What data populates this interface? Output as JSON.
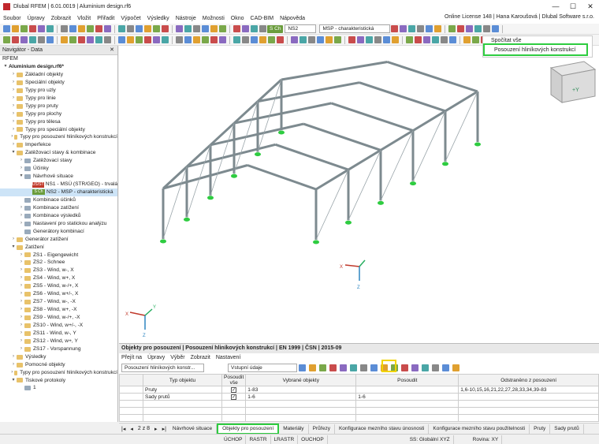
{
  "window": {
    "title": "Dlubal RFEM | 6.01.0019 | Aluminium design.rf6"
  },
  "menu": {
    "items": [
      "Soubor",
      "Úpravy",
      "Zobrazit",
      "Vložit",
      "Přiřadit",
      "Výpočet",
      "Výsledky",
      "Nástroje",
      "Možnosti",
      "Okno",
      "CAD-BIM",
      "Nápověda"
    ],
    "license": "Online License 148 | Hana Karoušová | Dlubal Software s.r.o."
  },
  "toolbar": {
    "chip": "S Ch",
    "combo_ns": "NS2",
    "combo_msp": "MSP - charakteristická"
  },
  "navigator": {
    "title": "Navigátor - Data",
    "root": "RFEM",
    "items": [
      {
        "label": "Aluminium design.rf6*",
        "level": 0,
        "bold": true,
        "exp": "▾"
      },
      {
        "label": "Základní objekty",
        "level": 1,
        "exp": "›",
        "type": "folder"
      },
      {
        "label": "Speciální objekty",
        "level": 1,
        "exp": "›",
        "type": "folder"
      },
      {
        "label": "Typy pro uzly",
        "level": 1,
        "exp": "›",
        "type": "folder"
      },
      {
        "label": "Typy pro linie",
        "level": 1,
        "exp": "›",
        "type": "folder"
      },
      {
        "label": "Typy pro pruty",
        "level": 1,
        "exp": "›",
        "type": "folder"
      },
      {
        "label": "Typy pro plochy",
        "level": 1,
        "exp": "›",
        "type": "folder"
      },
      {
        "label": "Typy pro tělesa",
        "level": 1,
        "exp": "›",
        "type": "folder"
      },
      {
        "label": "Typy pro speciální objekty",
        "level": 1,
        "exp": "›",
        "type": "folder"
      },
      {
        "label": "Typy pro posouzení hliníkových konstrukcí",
        "level": 1,
        "exp": "›",
        "type": "folder"
      },
      {
        "label": "Imperfekce",
        "level": 1,
        "exp": "›",
        "type": "folder"
      },
      {
        "label": "Zatěžovací stavy & kombinace",
        "level": 1,
        "exp": "▾",
        "type": "folder"
      },
      {
        "label": "Zatěžovací stavy",
        "level": 2,
        "exp": "›",
        "type": "item"
      },
      {
        "label": "Účinky",
        "level": 2,
        "exp": "›",
        "type": "item"
      },
      {
        "label": "Návrhové situace",
        "level": 2,
        "exp": "▾",
        "type": "item"
      },
      {
        "label": "NS1 - MSÚ (STR/GEO) - trvalá",
        "level": 3,
        "chip": "ÚS/ST",
        "chipcolor": "#c0392b"
      },
      {
        "label": "NS2 - MSP - charakteristická",
        "level": 3,
        "chip": "S Ch",
        "chipcolor": "#6a9c3c",
        "selected": true
      },
      {
        "label": "Kombinace účinků",
        "level": 2,
        "exp": "",
        "type": "item"
      },
      {
        "label": "Kombinace zatížení",
        "level": 2,
        "exp": "›",
        "type": "item"
      },
      {
        "label": "Kombinace výsledků",
        "level": 2,
        "exp": "›",
        "type": "item"
      },
      {
        "label": "Nastavení pro statickou analýzu",
        "level": 2,
        "exp": "›",
        "type": "item"
      },
      {
        "label": "Generátory kombinací",
        "level": 2,
        "exp": "",
        "type": "item"
      },
      {
        "label": "Generátor zatížení",
        "level": 1,
        "exp": "›",
        "type": "folder"
      },
      {
        "label": "Zatížení",
        "level": 1,
        "exp": "▾",
        "type": "folder"
      },
      {
        "label": "ZS1 - Eigengewicht",
        "level": 2,
        "exp": "›",
        "type": "folder"
      },
      {
        "label": "ZS2 - Schnee",
        "level": 2,
        "exp": "›",
        "type": "folder"
      },
      {
        "label": "ZS3 - Wind, w-, X",
        "level": 2,
        "exp": "›",
        "type": "folder"
      },
      {
        "label": "ZS4 - Wind, w+, X",
        "level": 2,
        "exp": "›",
        "type": "folder"
      },
      {
        "label": "ZS5 - Wind, w-/+, X",
        "level": 2,
        "exp": "›",
        "type": "folder"
      },
      {
        "label": "ZS6 - Wind, w+/-, X",
        "level": 2,
        "exp": "›",
        "type": "folder"
      },
      {
        "label": "ZS7 - Wind, w-, -X",
        "level": 2,
        "exp": "›",
        "type": "folder"
      },
      {
        "label": "ZS8 - Wind, w+, -X",
        "level": 2,
        "exp": "›",
        "type": "folder"
      },
      {
        "label": "ZS9 - Wind, w-/+, -X",
        "level": 2,
        "exp": "›",
        "type": "folder"
      },
      {
        "label": "ZS10 - Wind, w+/-, -X",
        "level": 2,
        "exp": "›",
        "type": "folder"
      },
      {
        "label": "ZS11 - Wind, w-, Y",
        "level": 2,
        "exp": "›",
        "type": "folder"
      },
      {
        "label": "ZS12 - Wind, w+, Y",
        "level": 2,
        "exp": "›",
        "type": "folder"
      },
      {
        "label": "ZS17 - Vorspannung",
        "level": 2,
        "exp": "›",
        "type": "folder"
      },
      {
        "label": "Výsledky",
        "level": 1,
        "exp": "›",
        "type": "folder"
      },
      {
        "label": "Pomocné objekty",
        "level": 1,
        "exp": "›",
        "type": "folder"
      },
      {
        "label": "Typy pro posouzení hliníkových konstrukcí",
        "level": 1,
        "exp": "›",
        "type": "folder"
      },
      {
        "label": "Tiskové protokoly",
        "level": 1,
        "exp": "▾",
        "type": "folder"
      },
      {
        "label": "1",
        "level": 2,
        "exp": "",
        "type": "item"
      }
    ]
  },
  "dropdown": {
    "items": [
      "Spočítat vše",
      "Posouzení hliníkových konstrukcí"
    ]
  },
  "viewport": {
    "cube": "+Y",
    "axes": {
      "x": "X",
      "y": "Y",
      "z": "Z"
    }
  },
  "panel": {
    "title": "Objekty pro posouzení | Posouzení hliníkových konstrukcí | EN 1999 | ČSN | 2015-09",
    "menu": [
      "Přejít na",
      "Úpravy",
      "Výběr",
      "Zobrazit",
      "Nastavení"
    ],
    "combo1": "Posouzení hliníkových konstr...",
    "combo2": "Vstupní údaje",
    "headers": [
      "Typ objektu",
      "Posoudit vše",
      "Vybrané objekty",
      "Posoudit",
      "Odstraněno z posouzení"
    ],
    "rows": [
      {
        "type": "Pruty",
        "all": "✓",
        "selected": "1-83",
        "check": "",
        "removed": "1,6-10,15,16,21,22,27,28,33,34,39-83"
      },
      {
        "type": "Sady prutů",
        "all": "✓",
        "selected": "1-6",
        "check": "1-6",
        "removed": ""
      }
    ]
  },
  "tabs": {
    "pager": "2 z 8",
    "items": [
      "Návrhové situace",
      "Objekty pro posouzení",
      "Materiály",
      "Průřezy",
      "Konfigurace mezního stavu únosnosti",
      "Konfigurace mezního stavu použitelnosti",
      "Pruty",
      "Sady prutů"
    ],
    "active": 1
  },
  "status": {
    "items": [
      "ÚCHOP",
      "RASTR",
      "LRASTR",
      "OUCHOP"
    ],
    "cs": "SS: Globální XYZ",
    "plane": "Rovina: XY"
  }
}
